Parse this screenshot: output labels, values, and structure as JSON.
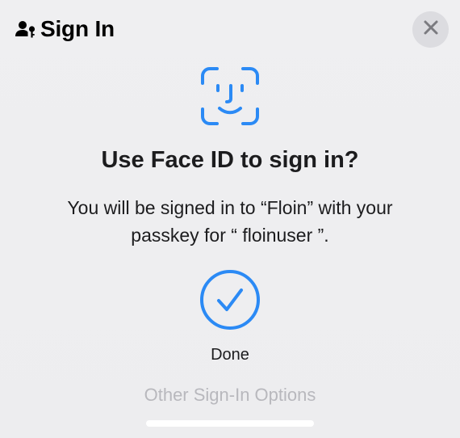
{
  "header": {
    "title": "Sign In",
    "icon": "person-key-icon"
  },
  "close": {
    "icon": "close-icon"
  },
  "faceid": {
    "icon": "face-id-icon",
    "color": "#2b8af5"
  },
  "dialog": {
    "headline": "Use Face ID to sign in?",
    "message": "You will be signed in to “Floin” with your passkey for “ floinuser ”."
  },
  "status": {
    "icon": "checkmark-circle-icon",
    "color": "#2b8af5",
    "label": "Done"
  },
  "footer": {
    "other_options_label": "Other Sign-In Options"
  }
}
